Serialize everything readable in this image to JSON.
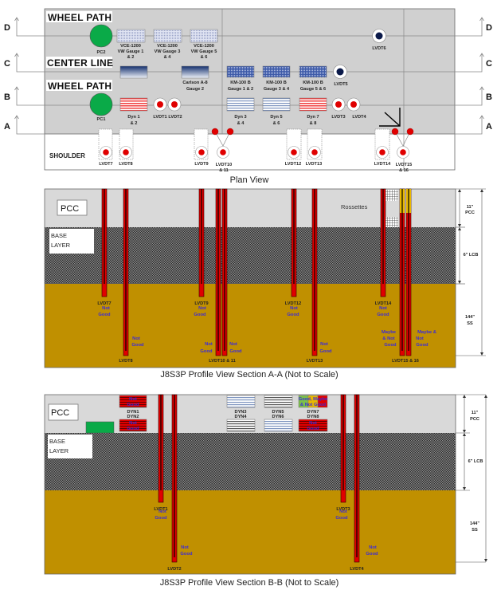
{
  "colors": {
    "pcc": "#d9d9d9",
    "base": "#3a3a3a",
    "subgrade": "#c09000",
    "sensor_red": "#e00000",
    "pc_green": "#0aaa48",
    "lvdt_navy": "#0b1a4a",
    "status_text": "#3a2bd8"
  },
  "plan": {
    "title": "Plan View",
    "lines": {
      "a": "A",
      "b": "B",
      "c": "C",
      "d": "D"
    },
    "wheel_path_top": "WHEEL PATH",
    "center_line": "CENTER LINE",
    "wheel_path_bottom": "WHEEL PATH",
    "shoulder": "SHOULDER",
    "pc2": "PC2",
    "pc1": "PC1",
    "vce": [
      [
        "VCE-1200",
        "VW Gauge 1",
        "& 2"
      ],
      [
        "VCE-1200",
        "VW Gauge 3",
        "& 4"
      ],
      [
        "VCE-1200",
        "VW Gauge 5",
        "& 6"
      ]
    ],
    "carlson": [
      "Carlson A-8",
      "Gauge 2"
    ],
    "km": [
      [
        "KM-100 B",
        "Gauge 1 & 2"
      ],
      [
        "KM-100 B",
        "Gauge 3 & 4"
      ],
      [
        "KM-100 B",
        "Gauge 5 & 6"
      ]
    ],
    "dyn": [
      [
        "Dyn 1",
        "& 2"
      ],
      [
        "Dyn 3",
        "& 4"
      ],
      [
        "Dyn 5",
        "& 6"
      ],
      [
        "Dyn 7",
        "& 8"
      ]
    ],
    "lvdt": {
      "l1": "LVDT1",
      "l2": "LVDT2",
      "l3": "LVDT3",
      "l4": "LVDT4",
      "l5": "LVDT5",
      "l6": "LVDT6",
      "l7": "LVDT7",
      "l8": "LVDT8",
      "l9": "LVDT9",
      "l10": [
        "LVDT10",
        "& 11"
      ],
      "l12": "LVDT12",
      "l13": "LVDT13",
      "l14": "LVDT14",
      "l15": [
        "LVDT15",
        "& 16"
      ]
    }
  },
  "section_aa": {
    "title": "J8S3P Profile View Section A-A (Not to Scale)",
    "pcc": "PCC",
    "base": [
      "BASE",
      "LAYER"
    ],
    "rosettes": "Rossettes",
    "dims": {
      "pcc": [
        "11\"",
        "PCC"
      ],
      "lcb": "6\" LCB",
      "ss": [
        "144\"",
        "SS"
      ]
    },
    "lvdts": {
      "l7": "LVDT7",
      "l8": "LVDT8",
      "l9": "LVDT9",
      "l10": "LVDT10 & 11",
      "l12": "LVDT12",
      "l13": "LVDT13",
      "l14": "LVDT14",
      "l15": "LVDT15 & 16"
    },
    "status": {
      "not_good": [
        "Not",
        "Good"
      ],
      "maybe_left": [
        "Maybe",
        "& Not",
        "Good"
      ],
      "maybe_right": [
        "Maybe &",
        "Not",
        "Good"
      ]
    }
  },
  "section_bb": {
    "title": "J8S3P Profile View Section B-B (Not to Scale)",
    "pcc": "PCC",
    "base": [
      "BASE",
      "LAYER"
    ],
    "dims": {
      "pcc": [
        "11\"",
        "PCC"
      ],
      "lcb": "6\" LCB",
      "ss": [
        "144\"",
        "SS"
      ]
    },
    "dyn_labels": [
      [
        "DYN1",
        "DYN2"
      ],
      [
        "DYN3",
        "DYN4"
      ],
      [
        "DYN5",
        "DYN6"
      ],
      [
        "DYN7",
        "DYN8"
      ]
    ],
    "dyn_status": {
      "not_good": [
        "Not",
        "Good"
      ],
      "mixed": [
        "Good, Maybe",
        "& Not Good"
      ]
    },
    "lvdts": {
      "l1": "LVDT1",
      "l2": "LVDT2",
      "l3": "LVDT3",
      "l4": "LVDT4"
    },
    "status": {
      "not_good": [
        "Not",
        "Good"
      ]
    }
  }
}
